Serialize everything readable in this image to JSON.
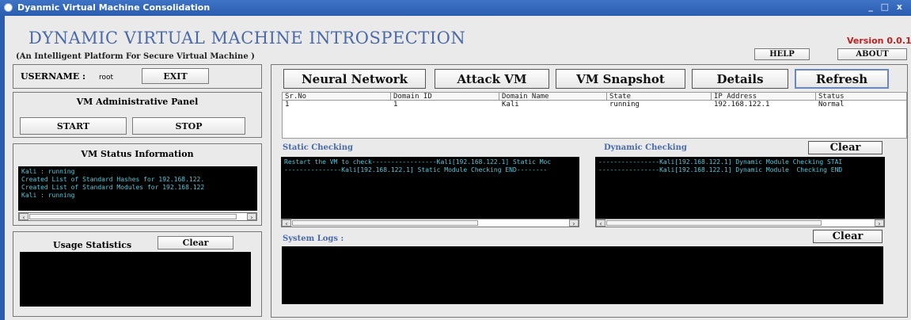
{
  "window": {
    "title": "Dyanmic Virtual Machine Consolidation",
    "controls": "_ □ x"
  },
  "header": {
    "title": "DYNAMIC VIRTUAL MACHINE INTROSPECTION",
    "subtitle": "(An Intelligent Platform For Secure Virtual Machine )",
    "version": "Version 0.0.1",
    "help_label": "HELP",
    "about_label": "ABOUT"
  },
  "user": {
    "label": "USERNAME :",
    "name": "root",
    "exit_label": "EXIT"
  },
  "admin": {
    "title": "VM Administrative  Panel",
    "start_label": "START",
    "stop_label": "STOP"
  },
  "status": {
    "title": "VM Status Information",
    "log": "Kali : running\nCreated List of Standard Hashes for 192.168.122.\nCreated List of Standard Modules for 192.168.122\nKali : running"
  },
  "usage": {
    "title": "Usage Statistics",
    "clear_label": "Clear"
  },
  "toolbar": {
    "neural_label": "Neural Network",
    "attack_label": "Attack VM",
    "snapshot_label": "VM Snapshot",
    "details_label": "Details",
    "refresh_label": "Refresh"
  },
  "table": {
    "headers": [
      "Sr.No",
      "Domain ID",
      "Domain Name",
      "State",
      "IP Address",
      "Status"
    ],
    "rows": [
      [
        "1",
        "1",
        "Kali",
        "running",
        "192.168.122.1",
        "Normal"
      ]
    ]
  },
  "static_check": {
    "title": "Static Checking",
    "log": "Restart the VM to check-----------------Kali[192.168.122.1] Static Moc\n---------------Kali[192.168.122.1] Static Module Checking END--------"
  },
  "dynamic_check": {
    "title": "Dynamic Checking",
    "clear_label": "Clear",
    "log": "----------------Kali[192.168.122.1] Dynamic Module Checking STAI\n----------------Kali[192.168.122.1] Dynamic Module  Checking END"
  },
  "system_logs": {
    "title": "System Logs :",
    "clear_label": "Clear"
  },
  "colors": {
    "title_bar": "#2a5db0",
    "heading_blue": "#4a6aa8",
    "version_red": "#c02020",
    "terminal_text": "#54c7d8"
  }
}
